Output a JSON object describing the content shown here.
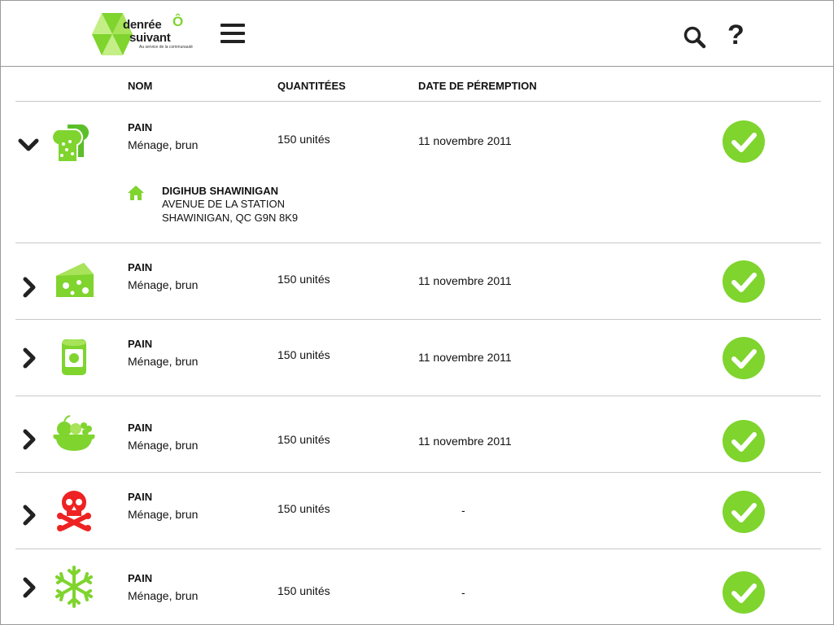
{
  "header": {
    "logo_line1": "denrée",
    "logo_o": "Ô",
    "logo_line2": "suivant",
    "logo_tagline": "Au service de la communauté",
    "help_label": "?"
  },
  "columns": {
    "name": "NOM",
    "quantity": "QUANTITÉES",
    "expiry": "DATE DE PÉREMPTION"
  },
  "colors": {
    "accent_green": "#7fd42e",
    "danger_red": "#ee2222",
    "dark": "#222222"
  },
  "items": [
    {
      "name": "PAIN",
      "description": "Ménage, brun",
      "quantity": "150 unités",
      "expiry": "11 novembre 2011",
      "icon": "bread-icon",
      "expanded": true,
      "address": {
        "line1": "DIGIHUB SHAWINIGAN",
        "line2": "AVENUE DE LA STATION",
        "line3": "SHAWINIGAN, QC G9N 8K9"
      }
    },
    {
      "name": "PAIN",
      "description": "Ménage, brun",
      "quantity": "150 unités",
      "expiry": "11 novembre 2011",
      "icon": "cheese-icon",
      "expanded": false
    },
    {
      "name": "PAIN",
      "description": "Ménage, brun",
      "quantity": "150 unités",
      "expiry": "11 novembre 2011",
      "icon": "can-icon",
      "expanded": false
    },
    {
      "name": "PAIN",
      "description": "Ménage, brun",
      "quantity": "150 unités",
      "expiry": "11 novembre 2011",
      "icon": "fruit-basket-icon",
      "expanded": false
    },
    {
      "name": "PAIN",
      "description": "Ménage, brun",
      "quantity": "150 unités",
      "expiry": "-",
      "icon": "skull-crossbones-icon",
      "expanded": false
    },
    {
      "name": "PAIN",
      "description": "Ménage, brun",
      "quantity": "150 unités",
      "expiry": "-",
      "icon": "snowflake-icon",
      "expanded": false
    }
  ]
}
